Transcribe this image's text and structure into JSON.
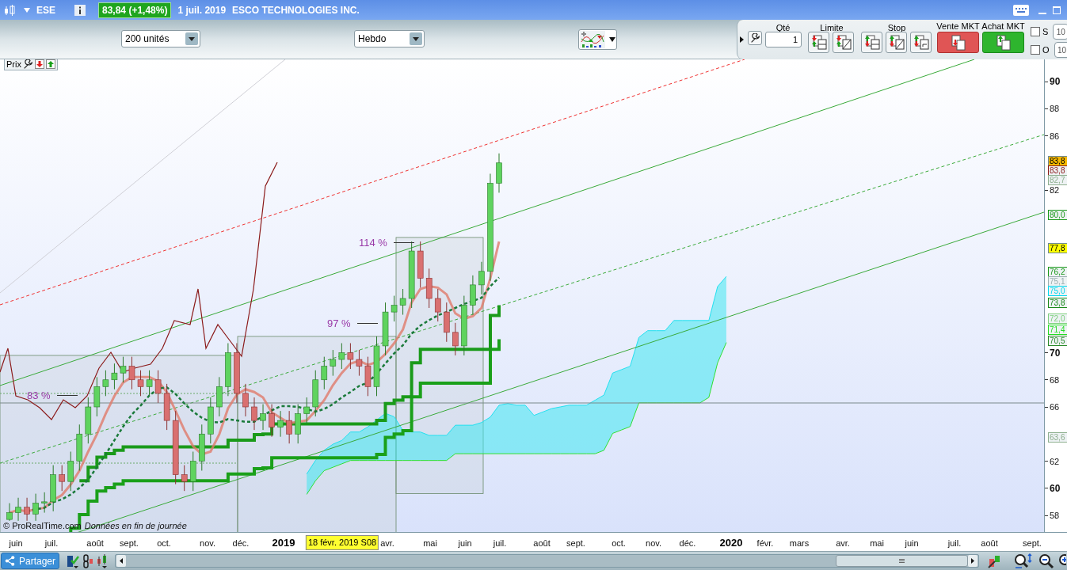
{
  "title_bar": {
    "symbol": "ESE",
    "quote": "83,84 (+1,48%)",
    "date": "1 juil. 2019",
    "company": "ESCO TECHNOLOGIES INC."
  },
  "toolbar": {
    "units_dropdown": "200 unités",
    "period_dropdown": "Hebdo"
  },
  "order_panel": {
    "qty_label": "Qté",
    "qty": "1",
    "limit_label": "Limite",
    "stop_label": "Stop",
    "sell_label": "Vente MKT",
    "buy_label": "Achat MKT",
    "options": [
      {
        "label": "S",
        "checked": false,
        "value": "10"
      },
      {
        "label": "O",
        "checked": false,
        "value": "10"
      }
    ]
  },
  "chart": {
    "panel_label": "Prix",
    "percent_labels": [
      {
        "text": "83 %"
      },
      {
        "text": "97 %"
      },
      {
        "text": "114 %"
      }
    ],
    "y_ticks": [
      {
        "label": "90",
        "major": true
      },
      {
        "label": "88",
        "major": false
      },
      {
        "label": "86",
        "major": false
      },
      {
        "label": "82",
        "major": false
      },
      {
        "label": "70",
        "major": true
      },
      {
        "label": "68",
        "major": false
      },
      {
        "label": "66",
        "major": false
      },
      {
        "label": "62",
        "major": false
      },
      {
        "label": "60",
        "major": true
      },
      {
        "label": "58",
        "major": false
      }
    ],
    "price_tags": [
      {
        "text": "83,8",
        "kind": "filled",
        "color": "#f5b800"
      },
      {
        "text": "83,8",
        "kind": "outline",
        "color": "#8b1a1a"
      },
      {
        "text": "82,7",
        "kind": "outline",
        "color": "#8fb08f"
      },
      {
        "text": "80,0",
        "kind": "outline",
        "color": "#1a9a1a"
      },
      {
        "text": "77,8",
        "kind": "filled",
        "color": "#ffff00"
      },
      {
        "text": "76,2",
        "kind": "outline",
        "color": "#1a9a1a"
      },
      {
        "text": "75,1",
        "kind": "outline",
        "color": "#9aaeb0"
      },
      {
        "text": "75,0",
        "kind": "outline",
        "color": "#00d8f0"
      },
      {
        "text": "73,8",
        "kind": "outline",
        "color": "#1a8a1a"
      },
      {
        "text": "72,0",
        "kind": "outline",
        "color": "#7ed07e"
      },
      {
        "text": "71,4",
        "kind": "outline",
        "color": "#22dd22"
      },
      {
        "text": "70,5",
        "kind": "outline",
        "color": "#2a8a2a"
      },
      {
        "text": "63,6",
        "kind": "outline",
        "color": "#8fb08f"
      }
    ],
    "x_labels": [
      {
        "text": "juin",
        "kind": "month"
      },
      {
        "text": "juil.",
        "kind": "month"
      },
      {
        "text": "août",
        "kind": "month"
      },
      {
        "text": "sept.",
        "kind": "month"
      },
      {
        "text": "oct.",
        "kind": "month"
      },
      {
        "text": "nov.",
        "kind": "month"
      },
      {
        "text": "déc.",
        "kind": "month"
      },
      {
        "text": "2019",
        "kind": "year"
      },
      {
        "text": "18 févr. 2019 S08",
        "kind": "cursor"
      },
      {
        "text": "avr.",
        "kind": "month"
      },
      {
        "text": "mai",
        "kind": "month"
      },
      {
        "text": "juin",
        "kind": "month"
      },
      {
        "text": "juil.",
        "kind": "month"
      },
      {
        "text": "août",
        "kind": "month"
      },
      {
        "text": "sept.",
        "kind": "month"
      },
      {
        "text": "oct.",
        "kind": "month"
      },
      {
        "text": "nov.",
        "kind": "month"
      },
      {
        "text": "déc.",
        "kind": "month"
      },
      {
        "text": "2020",
        "kind": "year"
      },
      {
        "text": "févr.",
        "kind": "month"
      },
      {
        "text": "mars",
        "kind": "month"
      },
      {
        "text": "avr.",
        "kind": "month"
      },
      {
        "text": "mai",
        "kind": "month"
      },
      {
        "text": "juin",
        "kind": "month"
      },
      {
        "text": "juil.",
        "kind": "month"
      },
      {
        "text": "août",
        "kind": "month"
      },
      {
        "text": "sept.",
        "kind": "month"
      }
    ],
    "copyright": "© ProRealTime.com",
    "data_note": "Données en fin de journée"
  },
  "bottom_bar": {
    "share_button": "Partager"
  }
}
